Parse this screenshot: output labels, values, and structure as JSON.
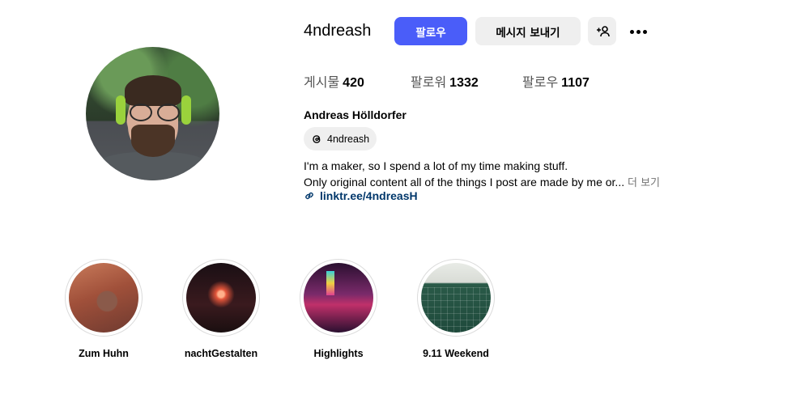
{
  "profile": {
    "username": "4ndreash",
    "follow_label": "팔로우",
    "message_label": "메시지 보내기",
    "stats": {
      "posts_label": "게시물",
      "posts_value": "420",
      "followers_label": "팔로워",
      "followers_value": "1332",
      "following_label": "팔로우",
      "following_value": "1107"
    },
    "full_name": "Andreas Hölldorfer",
    "threads_handle": "4ndreash",
    "bio_line1": "I'm a maker, so I spend a lot of my time making stuff.",
    "bio_line2": "Only original content all of the things I post are made by me or...",
    "more_label": "더 보기",
    "link": "linktr.ee/4ndreasH",
    "icons": [
      "suggest-user-icon",
      "more-options-icon",
      "threads-icon",
      "link-icon"
    ]
  },
  "highlights": [
    {
      "label": "Zum Huhn"
    },
    {
      "label": "nachtGestalten"
    },
    {
      "label": "Highlights"
    },
    {
      "label": "9.11 Weekend"
    }
  ],
  "colors": {
    "follow_button": "#4a5df9",
    "secondary_button": "#efefef",
    "link_text": "#00376b",
    "muted_text": "#737373"
  }
}
